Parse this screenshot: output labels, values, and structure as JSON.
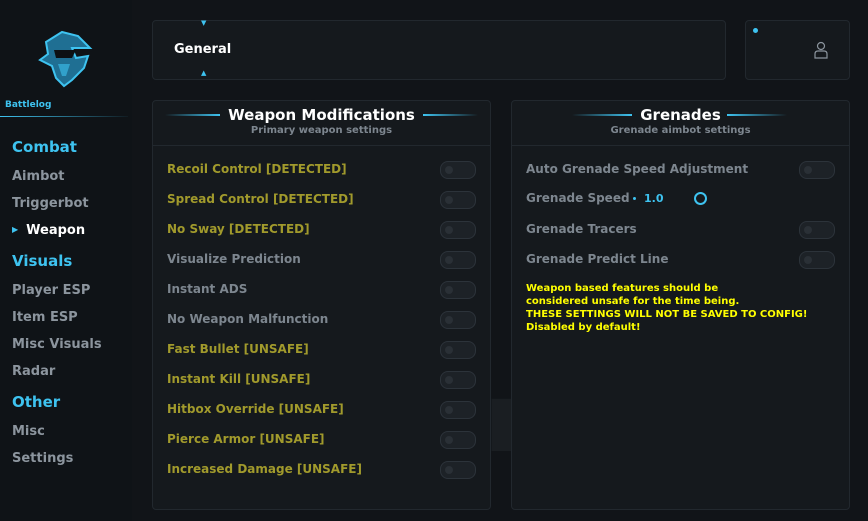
{
  "sidebar": {
    "brand": "Battlelog",
    "sections": [
      {
        "label": "Combat",
        "items": [
          "Aimbot",
          "Triggerbot",
          "Weapon"
        ]
      },
      {
        "label": "Visuals",
        "items": [
          "Player ESP",
          "Item ESP",
          "Misc Visuals",
          "Radar"
        ]
      },
      {
        "label": "Other",
        "items": [
          "Misc",
          "Settings"
        ]
      }
    ],
    "active_item": "Weapon"
  },
  "header": {
    "tab_label": "General"
  },
  "weapon_panel": {
    "title": "Weapon Modifications",
    "subtitle": "Primary weapon settings",
    "options": [
      {
        "label": "Recoil Control [DETECTED]",
        "enabled": false
      },
      {
        "label": "Spread Control [DETECTED]",
        "enabled": false
      },
      {
        "label": "No Sway [DETECTED]",
        "enabled": false
      },
      {
        "label": "Visualize Prediction",
        "enabled": false
      },
      {
        "label": "Instant ADS",
        "enabled": false
      },
      {
        "label": "No Weapon Malfunction",
        "enabled": false
      },
      {
        "label": "Fast Bullet [UNSAFE]",
        "enabled": false
      },
      {
        "label": "Instant Kill [UNSAFE]",
        "enabled": false
      },
      {
        "label": "Hitbox Override [UNSAFE]",
        "enabled": false
      },
      {
        "label": "Pierce Armor [UNSAFE]",
        "enabled": false
      },
      {
        "label": "Increased Damage [UNSAFE]",
        "enabled": false
      }
    ]
  },
  "grenade_panel": {
    "title": "Grenades",
    "subtitle": "Grenade aimbot settings",
    "auto_speed": {
      "label": "Auto Grenade Speed Adjustment",
      "enabled": false
    },
    "speed": {
      "label": "Grenade Speed",
      "value": "1.0"
    },
    "tracers": {
      "label": "Grenade Tracers",
      "enabled": false
    },
    "predict_line": {
      "label": "Grenade Predict Line",
      "enabled": false
    },
    "notice": [
      "Weapon based features should be",
      "considered unsafe for the time being.",
      "THESE SETTINGS WILL NOT BE SAVED TO CONFIG!",
      "Disabled by default!"
    ]
  },
  "colors": {
    "accent": "#3ec3f0",
    "warning_label": "#a19a2c",
    "notice": "#ffff00"
  },
  "icons": {
    "logo": "knight-helmet-logo",
    "profile": "user-icon"
  }
}
